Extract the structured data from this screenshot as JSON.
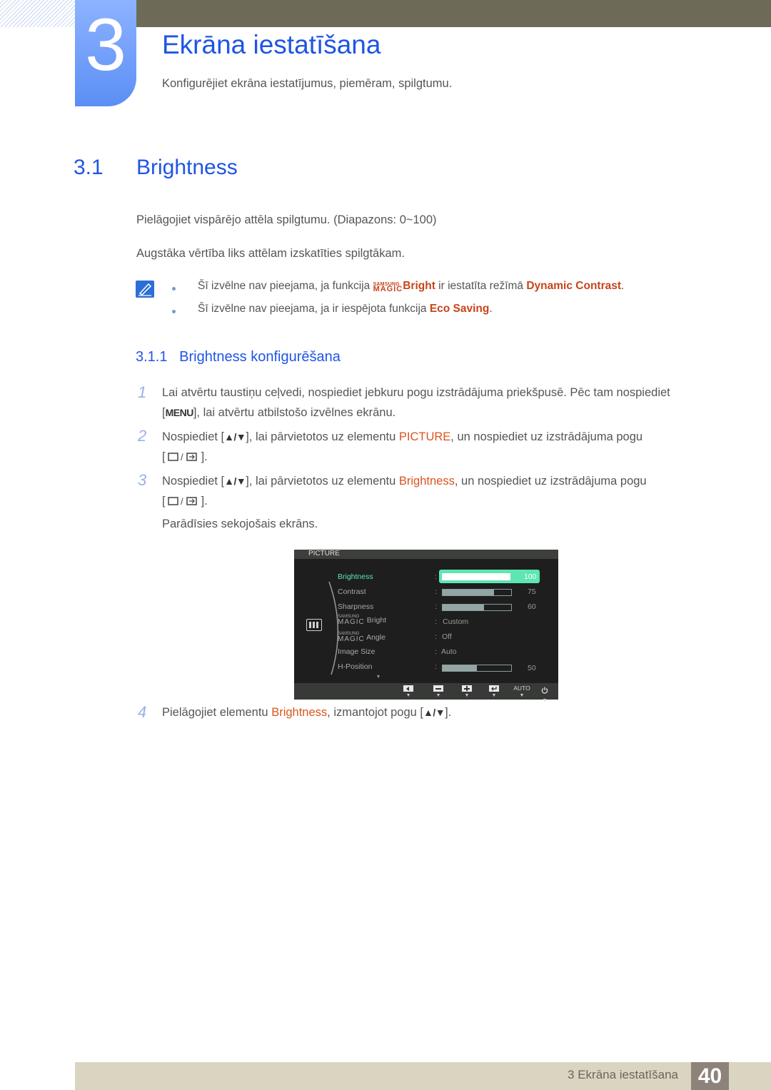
{
  "chapter": {
    "number": "3",
    "title": "Ekrāna iestatīšana",
    "subtitle": "Konfigurējiet ekrāna iestatījumus, piemēram, spilgtumu."
  },
  "section": {
    "number": "3.1",
    "title": "Brightness",
    "para1": "Pielāgojiet vispārējo attēla spilgtumu. (Diapazons: 0~100)",
    "para2": "Augstāka vērtība liks attēlam izskatīties spilgtākam."
  },
  "notes": [
    {
      "pre": "Šī izvēlne nav pieejama, ja funkcija ",
      "magic_small": "SAMSUNG",
      "magic_big": "MAGIC",
      "magic_word": "Bright",
      "mid": " ir iestatīta režīmā ",
      "highlight": "Dynamic Contrast",
      "post": "."
    },
    {
      "pre": "Šī izvēlne nav pieejama, ja ir iespējota funkcija ",
      "highlight": "Eco Saving",
      "post": "."
    }
  ],
  "subsection": {
    "number": "3.1.1",
    "title": "Brightness konfigurēšana"
  },
  "steps": [
    {
      "num": "1",
      "line1": "Lai atvērtu taustiņu ceļvedi, nospiediet jebkuru pogu izstrādājuma priekšpusē. Pēc tam nospiediet",
      "line2_key": "MENU",
      "line2": "], lai atvērtu atbilstošo izvēlnes ekrānu."
    },
    {
      "num": "2",
      "pre": "Nospiediet [",
      "keys": "▲/▼",
      "mid": "], lai pārvietotos uz elementu ",
      "highlight": "PICTURE",
      "post": ", un nospiediet uz izstrādājuma pogu",
      "line2": "]."
    },
    {
      "num": "3",
      "pre": "Nospiediet [",
      "keys": "▲/▼",
      "mid": "], lai pārvietotos uz elementu ",
      "highlight": "Brightness",
      "post": ", un nospiediet uz izstrādājuma pogu",
      "line2": "].",
      "after": "Parādīsies sekojošais ekrāns."
    },
    {
      "num": "4",
      "pre": "Pielāgojiet elementu ",
      "highlight": "Brightness",
      "mid": ", izmantojot pogu [",
      "keys": "▲/▼",
      "post": "]."
    }
  ],
  "osd": {
    "header": "PICTURE",
    "items": [
      {
        "label": "Brightness",
        "value": "100",
        "level": 100,
        "selected": true
      },
      {
        "label": "Contrast",
        "value": "75",
        "level": 75
      },
      {
        "label": "Sharpness",
        "value": "60",
        "level": 60
      },
      {
        "magic_small": "SAMSUNG",
        "magic_big": "MAGIC",
        "label": "Bright",
        "value": "Custom"
      },
      {
        "magic_small": "SAMSUNG",
        "magic_big": "MAGIC",
        "label": "Angle",
        "value": "Off"
      },
      {
        "label": "Image Size",
        "value": "Auto"
      },
      {
        "label": "H-Position",
        "value": "50",
        "level": 50
      }
    ],
    "footer_buttons": [
      "left-arrow",
      "minus",
      "plus",
      "enter",
      "AUTO",
      "power"
    ],
    "auto_label": "AUTO",
    "colon": ":"
  },
  "footer": {
    "label": "3 Ekrāna iestatīšana",
    "page": "40"
  },
  "colors": {
    "heading_blue": "#1f55e6",
    "highlight_orange": "#c8441a",
    "osd_selected": "#5ee6b2"
  }
}
